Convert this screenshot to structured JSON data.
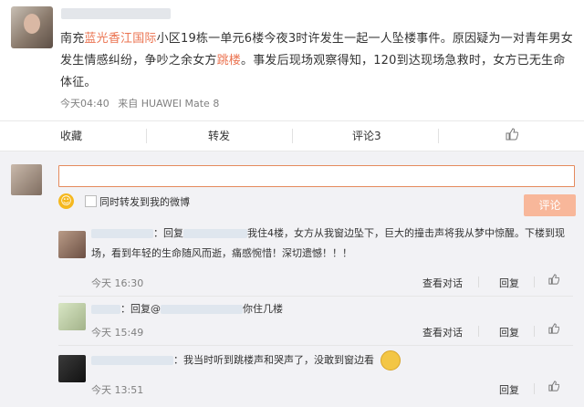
{
  "post": {
    "text_prefix": "南充",
    "link_text": "蓝光香江国际",
    "text_middle": "小区19栋一单元6楼今夜3时许发生一起一人坠楼事件。原因疑为一对青年男女发生情感纠纷，争吵之余女方",
    "link_text_2": "跳楼",
    "text_suffix": "。事发后现场观察得知，120到达现场急救时，女方已无生命体征。",
    "time": "今天04:40",
    "source": "来自 HUAWEI Mate 8"
  },
  "actions": {
    "favorite": "收藏",
    "repost": "转发",
    "comment": "评论3",
    "like_icon": "thumbs-up-icon"
  },
  "composer": {
    "forward_label": "同时转发到我的微博",
    "submit_label": "评论"
  },
  "comments": [
    {
      "prefix": "：回复",
      "text": "我住4楼，女方从我窗边坠下，巨大的撞击声将我从梦中惊醒。下楼到现场，看到年轻的生命随风而逝，痛感惋惜！深切遗憾！！！",
      "time": "今天 16:30",
      "view_conversation": "查看对话",
      "reply": "回复"
    },
    {
      "prefix": "：回复@",
      "text": "你住几楼",
      "time": "今天 15:49",
      "view_conversation": "查看对话",
      "reply": "回复"
    },
    {
      "prefix": "：",
      "text": "我当时听到跳楼声和哭声了，没敢到窗边看",
      "time": "今天 13:51",
      "reply": "回复"
    }
  ],
  "colors": {
    "link": "#eb7350",
    "accent_button": "#f8b79a",
    "comment_bg": "#f2f2f5"
  }
}
